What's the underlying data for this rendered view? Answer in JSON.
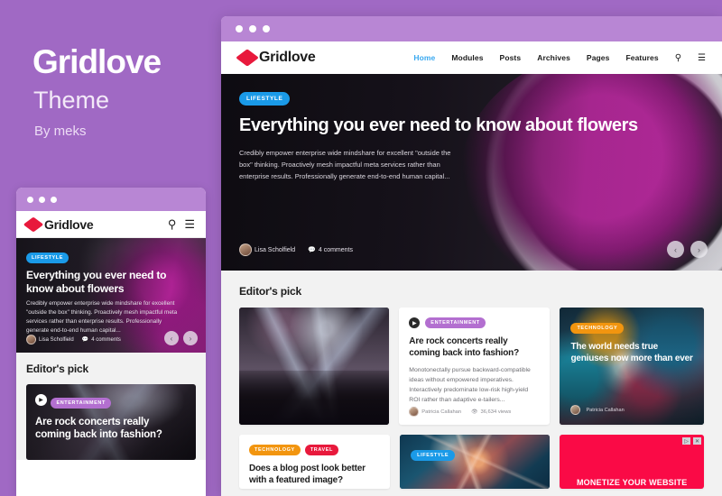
{
  "promo": {
    "title": "Gridlove",
    "subtitle": "Theme",
    "byline": "By meks",
    "bg_color": "#a069c4"
  },
  "brand": {
    "name": "Gridlove",
    "logo_color": "#e8193c"
  },
  "browser": {
    "chrome_color": "#b886d4",
    "nav": {
      "items": [
        {
          "label": "Home",
          "active": true
        },
        {
          "label": "Modules",
          "active": false
        },
        {
          "label": "Posts",
          "active": false
        },
        {
          "label": "Archives",
          "active": false
        },
        {
          "label": "Pages",
          "active": false
        },
        {
          "label": "Features",
          "active": false
        }
      ],
      "search_icon": "search-icon",
      "menu_icon": "hamburger-icon",
      "active_color": "#38a8f0"
    }
  },
  "hero": {
    "category": "LIFESTYLE",
    "category_color": "#1a9ae8",
    "title": "Everything you ever need to know about flowers",
    "excerpt": "Credibly empower enterprise wide mindshare for excellent \"outside the box\" thinking. Proactively mesh impactful meta services rather than enterprise results. Professionally generate end-to-end human capital...",
    "author": "Lisa Scholfield",
    "comments": "4 comments",
    "prev_icon": "chevron-left-icon",
    "next_icon": "chevron-right-icon",
    "prev_glyph": "‹",
    "next_glyph": "›"
  },
  "section": {
    "editors_pick": "Editor's pick"
  },
  "cards": {
    "concert_image": {
      "alt": "concert-crowd-photo"
    },
    "rock": {
      "category": "ENTERTAINMENT",
      "category_color": "#b36fd0",
      "play_icon": "play-icon",
      "title": "Are rock concerts really coming back into fashion?",
      "excerpt": "Monotonectally pursue backward-compatible ideas without empowered imperatives. Interactively predominate low-risk high-yield ROI rather than adaptive e-tailers...",
      "author": "Patricia Callahan",
      "views": "36,634 views",
      "views_icon": "eye-icon"
    },
    "genius": {
      "category": "TECHNOLOGY",
      "category_color": "#f2950f",
      "title": "The world needs true geniuses now more than ever",
      "author": "Patricia Callahan"
    },
    "blog": {
      "categories": [
        {
          "label": "TECHNOLOGY",
          "color": "#f2950f"
        },
        {
          "label": "TRAVEL",
          "color": "#e8193c"
        }
      ],
      "title": "Does a blog post look better with a featured image?"
    },
    "jelly": {
      "category": "LIFESTYLE",
      "category_color": "#1a9ae8"
    },
    "ad": {
      "text": "MONETIZE YOUR WEBSITE",
      "bg_color": "#fa0a46",
      "icon_1": "ad-choices-icon",
      "icon_2": "close-ad-icon",
      "glyph_1": "▷",
      "glyph_2": "✕"
    }
  },
  "phone": {
    "hero": {
      "category": "LIFESTYLE",
      "title": "Everything you ever need to know about flowers",
      "excerpt": "Credibly empower enterprise wide mindshare for excellent \"outside the box\" thinking. Proactively mesh impactful meta services rather than enterprise results. Professionally generate end-to-end human capital...",
      "author": "Lisa Scholfield",
      "comments": "4 comments"
    },
    "section_title": "Editor's pick",
    "card": {
      "category": "ENTERTAINMENT",
      "title": "Are rock concerts really coming back into fashion?",
      "play_icon": "play-icon"
    }
  }
}
